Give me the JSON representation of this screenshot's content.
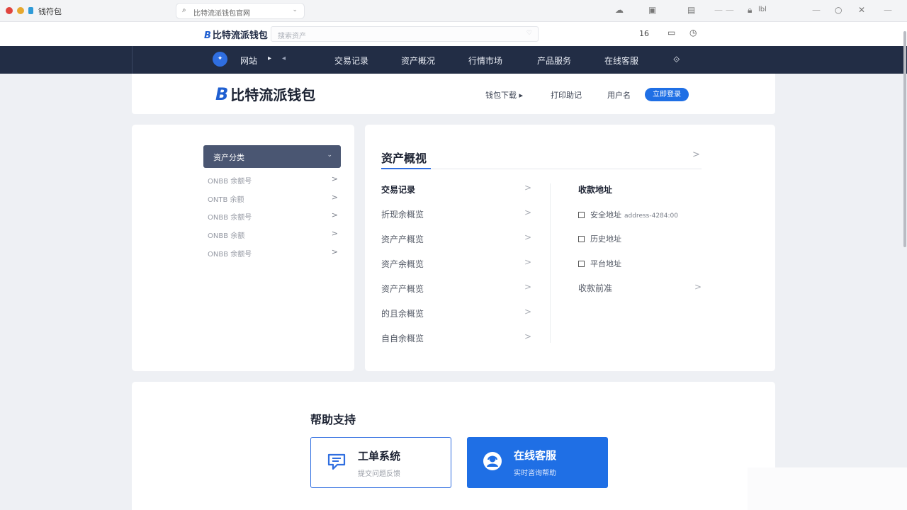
{
  "window": {
    "title": "钱符包",
    "url": "比特流派钱包官网",
    "toolbar_text": "lbl"
  },
  "header": {
    "logo_text": "比特流派钱包",
    "search_placeholder": "搜索资产",
    "badge_count": "16"
  },
  "nav": {
    "items": [
      "网站",
      "交易记录",
      "资产概况",
      "行情市场",
      "产品服务",
      "在线客服"
    ]
  },
  "brand": {
    "logo_text": "比特流派钱包",
    "links": [
      "钱包下载",
      "打印助记",
      "用户名"
    ],
    "button_label": "立即登录"
  },
  "sidebar": {
    "active_label": "资产分类",
    "items": [
      {
        "label": "ONBB 余额号"
      },
      {
        "label": "ONTB 余额"
      },
      {
        "label": "ONBB 余额号"
      },
      {
        "label": "ONBB 余额"
      },
      {
        "label": "ONBB 余额号"
      }
    ]
  },
  "main": {
    "title": "资产概视",
    "list": [
      {
        "label": "交易记录",
        "strong": true
      },
      {
        "label": "折现余概览"
      },
      {
        "label": "资产产概览"
      },
      {
        "label": "资产余概览"
      },
      {
        "label": "资产产概览"
      },
      {
        "label": "的且余概览"
      },
      {
        "label": "自自余概览"
      }
    ],
    "address": {
      "title": "收款地址",
      "items": [
        {
          "label": "安全地址",
          "value": "address-4284:00"
        },
        {
          "label": "历史地址",
          "value": ""
        },
        {
          "label": "平台地址",
          "value": ""
        }
      ],
      "more_label": "收款前准"
    }
  },
  "help": {
    "title": "帮助支持",
    "ticket": {
      "title": "工单系统",
      "subtitle": "提交问题反馈"
    },
    "service": {
      "title": "在线客服",
      "subtitle": "实时咨询帮助"
    }
  },
  "colors": {
    "nav_bg": "#222d45",
    "accent": "#1f6fe5",
    "sidebar_active": "#4a5672"
  }
}
